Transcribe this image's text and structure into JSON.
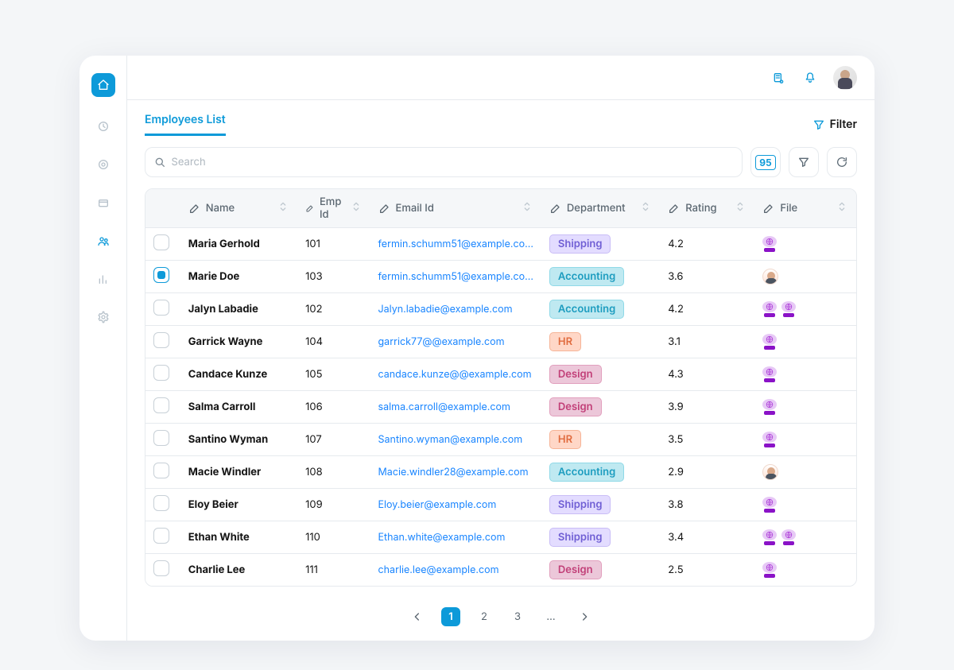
{
  "page": {
    "title": "Employees List"
  },
  "header": {
    "filter_label": "Filter"
  },
  "toolbar": {
    "search_placeholder": "Search",
    "result_count": "95"
  },
  "table": {
    "columns": {
      "name": "Name",
      "emp_id": "Emp Id",
      "email": "Email Id",
      "department": "Department",
      "rating": "Rating",
      "file": "File"
    },
    "rows": [
      {
        "checked": false,
        "name": "Maria Gerhold",
        "emp_id": "101",
        "email": "fermin.schumm51@example.co...",
        "department": "Shipping",
        "rating": "4.2",
        "files": [
          "chip"
        ]
      },
      {
        "checked": true,
        "name": "Marie Doe",
        "emp_id": "103",
        "email": "fermin.schumm51@example.co...",
        "department": "Accounting",
        "rating": "3.6",
        "files": [
          "face"
        ]
      },
      {
        "checked": false,
        "name": "Jalyn Labadie",
        "emp_id": "102",
        "email": "Jalyn.labadie@example.com",
        "department": "Accounting",
        "rating": "4.2",
        "files": [
          "chip",
          "chip"
        ]
      },
      {
        "checked": false,
        "name": "Garrick Wayne",
        "emp_id": "104",
        "email": "garrick77@@example.com",
        "department": "HR",
        "rating": "3.1",
        "files": [
          "chip"
        ]
      },
      {
        "checked": false,
        "name": "Candace Kunze",
        "emp_id": "105",
        "email": "candace.kunze@@example.com",
        "department": "Design",
        "rating": "4.3",
        "files": [
          "chip"
        ]
      },
      {
        "checked": false,
        "name": "Salma Carroll",
        "emp_id": "106",
        "email": "salma.carroll@example.com",
        "department": "Design",
        "rating": "3.9",
        "files": [
          "chip"
        ]
      },
      {
        "checked": false,
        "name": "Santino Wyman",
        "emp_id": "107",
        "email": "Santino.wyman@example.com",
        "department": "HR",
        "rating": "3.5",
        "files": [
          "chip"
        ]
      },
      {
        "checked": false,
        "name": "Macie Windler",
        "emp_id": "108",
        "email": "Macie.windler28@example.com",
        "department": "Accounting",
        "rating": "2.9",
        "files": [
          "face"
        ]
      },
      {
        "checked": false,
        "name": "Eloy Beier",
        "emp_id": "109",
        "email": "Eloy.beier@example.com",
        "department": "Shipping",
        "rating": "3.8",
        "files": [
          "chip"
        ]
      },
      {
        "checked": false,
        "name": "Ethan White",
        "emp_id": "110",
        "email": "Ethan.white@example.com",
        "department": "Shipping",
        "rating": "3.4",
        "files": [
          "chip",
          "chip"
        ]
      },
      {
        "checked": false,
        "name": "Charlie Lee",
        "emp_id": "111",
        "email": "charlie.lee@example.com",
        "department": "Design",
        "rating": "2.5",
        "files": [
          "chip"
        ]
      }
    ]
  },
  "pagination": {
    "pages": [
      "1",
      "2",
      "3",
      "…"
    ],
    "current": "1"
  }
}
